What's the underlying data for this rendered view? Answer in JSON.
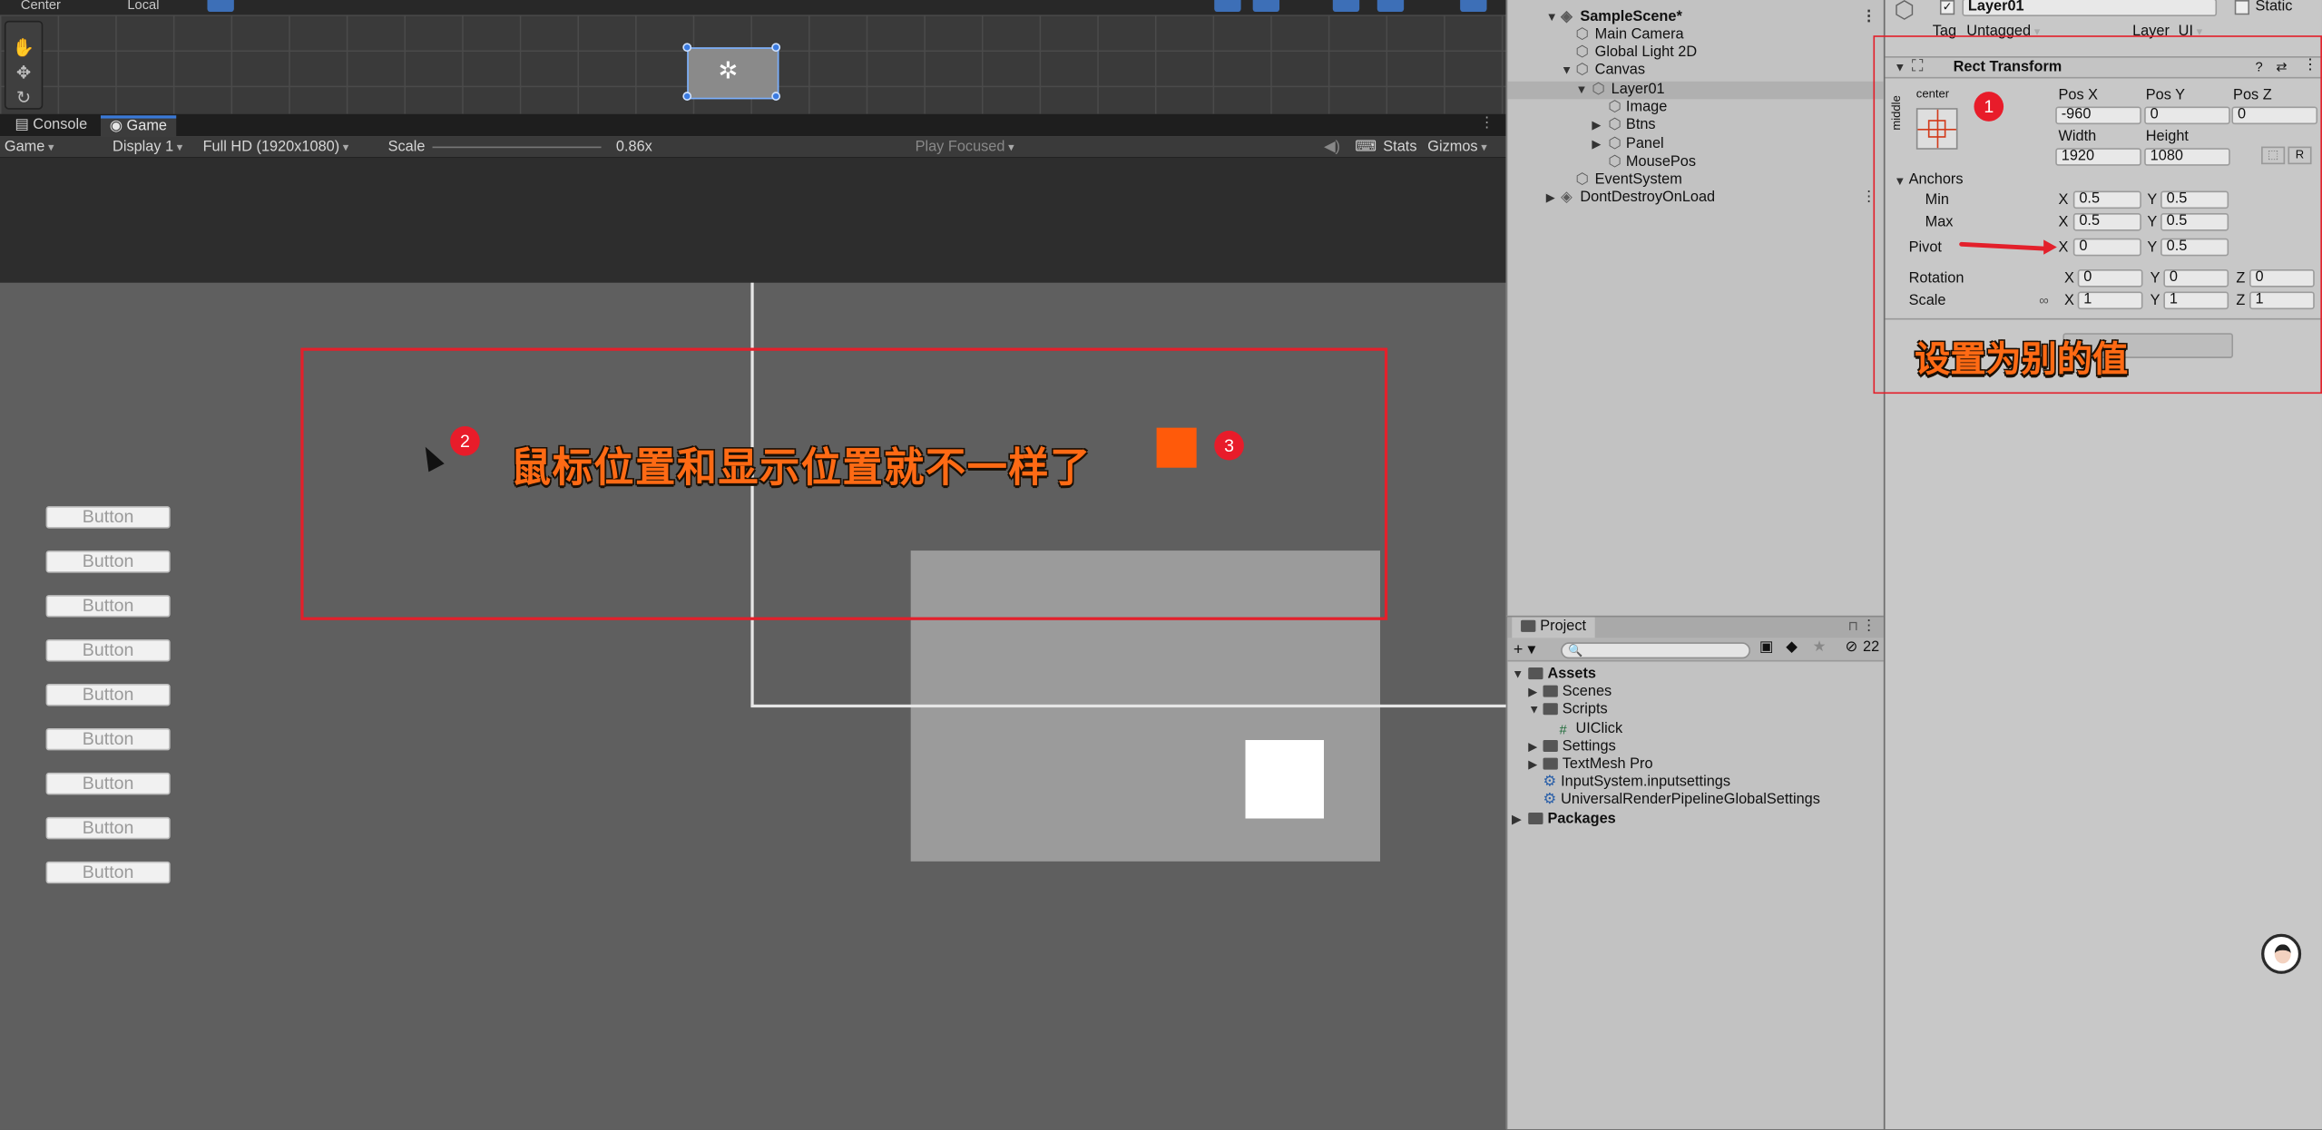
{
  "scene_toolbar": {
    "pivot_mode": "Center",
    "pivot_rotation": "Local"
  },
  "tabs": {
    "console": "Console",
    "game": "Game"
  },
  "game_toolbar": {
    "display_mode": "Game",
    "display": "Display 1",
    "resolution": "Full HD (1920x1080)",
    "scale_label": "Scale",
    "scale_value": "0.86x",
    "play_mode": "Play Focused",
    "stats": "Stats",
    "gizmos": "Gizmos"
  },
  "game_view": {
    "buttons": [
      "Button",
      "Button",
      "Button",
      "Button",
      "Button",
      "Button",
      "Button",
      "Button",
      "Button"
    ],
    "annotation_text": "鼠标位置和显示位置就不一样了",
    "badge_2": "2",
    "badge_3": "3",
    "colors": {
      "orange_square": "#ff5a0a",
      "annotation_red": "#e3202b"
    }
  },
  "hierarchy": {
    "scene_name": "SampleScene*",
    "items": [
      {
        "label": "Main Camera"
      },
      {
        "label": "Global Light 2D"
      },
      {
        "label": "Canvas"
      },
      {
        "label": "Layer01"
      },
      {
        "label": "Image"
      },
      {
        "label": "Btns"
      },
      {
        "label": "Panel"
      },
      {
        "label": "MousePos"
      },
      {
        "label": "EventSystem"
      },
      {
        "label": "DontDestroyOnLoad"
      }
    ]
  },
  "project": {
    "tab": "Project",
    "hidden_count": "22",
    "items": [
      {
        "label": "Assets"
      },
      {
        "label": "Scenes"
      },
      {
        "label": "Scripts"
      },
      {
        "label": "UIClick"
      },
      {
        "label": "Settings"
      },
      {
        "label": "TextMesh Pro"
      },
      {
        "label": "InputSystem.inputsettings"
      },
      {
        "label": "UniversalRenderPipelineGlobalSettings"
      },
      {
        "label": "Packages"
      }
    ]
  },
  "inspector": {
    "object_name": "Layer01",
    "static_label": "Static",
    "tag_label": "Tag",
    "tag_value": "Untagged",
    "layer_label": "Layer",
    "layer_value": "UI",
    "component_title": "Rect Transform",
    "anchor_h": "center",
    "anchor_v": "middle",
    "badge_1": "1",
    "pos_x_label": "Pos X",
    "pos_y_label": "Pos Y",
    "pos_z_label": "Pos Z",
    "pos_x": "-960",
    "pos_y": "0",
    "pos_z": "0",
    "width_label": "Width",
    "height_label": "Height",
    "width": "1920",
    "height": "1080",
    "r_button": "R",
    "anchors_label": "Anchors",
    "min_label": "Min",
    "max_label": "Max",
    "min_x": "0.5",
    "min_y": "0.5",
    "max_x": "0.5",
    "max_y": "0.5",
    "pivot_label": "Pivot",
    "pivot_x": "0",
    "pivot_y": "0.5",
    "rotation_label": "Rotation",
    "rot_x": "0",
    "rot_y": "0",
    "rot_z": "0",
    "scale_label": "Scale",
    "scale_x": "1",
    "scale_y": "1",
    "scale_z": "1",
    "axis_x": "X",
    "axis_y": "Y",
    "axis_z": "Z",
    "annotation_text": "设置为别的值"
  }
}
